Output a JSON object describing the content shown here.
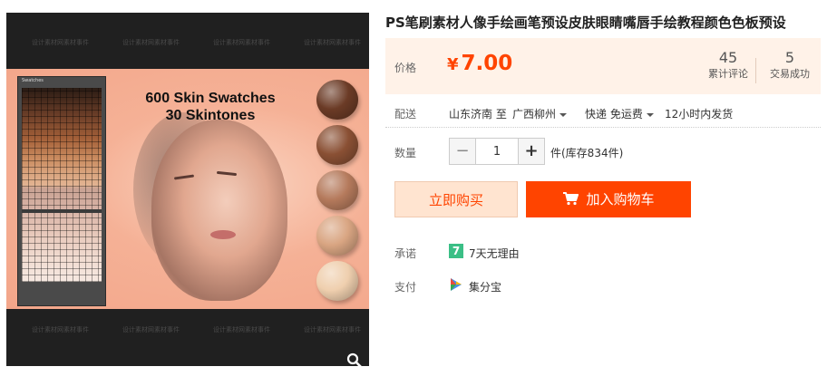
{
  "product": {
    "title": "PS笔刷素材人像手绘画笔预设皮肤眼睛嘴唇手绘教程颜色色板预设",
    "image": {
      "headline_line1": "600 Skin Swatches",
      "headline_line2": "30 Skintones",
      "swatch_panel_title": "Swatches",
      "watermark": "设计素材网素材事件",
      "skin_ball_colors": [
        "#6b3b26",
        "#8a5034",
        "#b57a5c",
        "#d9a582",
        "#efcfae"
      ]
    }
  },
  "price": {
    "label": "价格",
    "currency": "¥",
    "value": "7.00",
    "accent_color": "#ff4400",
    "reviews_count": "45",
    "reviews_label": "累计评论",
    "sales_count": "5",
    "sales_label": "交易成功"
  },
  "delivery": {
    "label": "配送",
    "from": "山东济南 至",
    "to": "广西柳州",
    "shipping": "快递 免运费",
    "dispatch": "12小时内发货"
  },
  "quantity": {
    "label": "数量",
    "minus": "−",
    "value": "1",
    "plus": "+",
    "stock": "件(库存834件)"
  },
  "actions": {
    "buy_now": "立即购买",
    "add_to_cart": "加入购物车"
  },
  "promise": {
    "label": "承诺",
    "badge": "7",
    "text": "7天无理由"
  },
  "payment": {
    "label": "支付",
    "text": "集分宝"
  }
}
